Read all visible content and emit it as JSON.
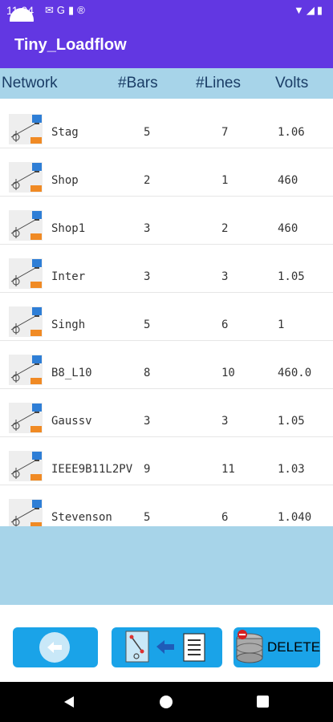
{
  "status_bar": {
    "time": "11:04",
    "notification_icons": [
      "mail-icon",
      "google-icon",
      "sim-icon",
      "settings-icon"
    ],
    "system_icons": [
      "wifi-icon",
      "signal-icon",
      "battery-icon"
    ]
  },
  "app": {
    "title": "Tiny_Loadflow",
    "bar_color": "#6237e2"
  },
  "table": {
    "headers": {
      "network": "Network",
      "bars": "#Bars",
      "lines": "#Lines",
      "volts": "Volts"
    },
    "header_color": "#a7d4e9",
    "rows": [
      {
        "name": "Stag",
        "bars": "5",
        "lines": "7",
        "volts": "1.06"
      },
      {
        "name": "Shop",
        "bars": "2",
        "lines": "1",
        "volts": "460"
      },
      {
        "name": "Shop1",
        "bars": "3",
        "lines": "2",
        "volts": "460"
      },
      {
        "name": "Inter",
        "bars": "3",
        "lines": "3",
        "volts": "1.05"
      },
      {
        "name": "Singh",
        "bars": "5",
        "lines": "6",
        "volts": "1"
      },
      {
        "name": "B8_L10",
        "bars": "8",
        "lines": "10",
        "volts": "460.0"
      },
      {
        "name": "Gaussv",
        "bars": "3",
        "lines": "3",
        "volts": "1.05"
      },
      {
        "name": "IEEE9B11L2PV",
        "bars": "9",
        "lines": "11",
        "volts": "1.03"
      },
      {
        "name": "Stevenson",
        "bars": "5",
        "lines": "6",
        "volts": "1.040"
      }
    ]
  },
  "toolbar": {
    "back_icon": "back-arrow-icon",
    "import_icon": "import-network-icon",
    "delete_label": "DELETE",
    "button_color": "#1aa3e8"
  }
}
